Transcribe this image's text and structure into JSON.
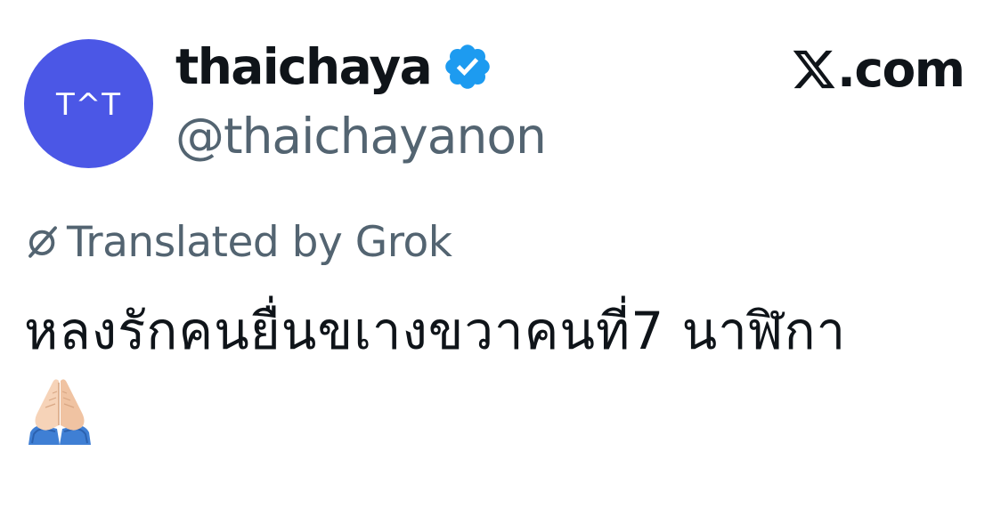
{
  "author": {
    "avatar_text": "T^T",
    "display_name": "thaichaya",
    "handle": "@thaichayanon",
    "verified": true,
    "verified_badge_icon": "verified-badge-icon",
    "avatar_color": "#4b57e6",
    "badge_color": "#1d9bf0"
  },
  "brand": {
    "logo_icon": "x-logo-icon",
    "domain_suffix": ".com"
  },
  "translation": {
    "icon": "grok-icon",
    "label": "Translated by Grok"
  },
  "tweet": {
    "text": "หลงรักคนยื่นขเางขวาคนที่7 นาฬิกา",
    "emoji": "folded-hands"
  },
  "colors": {
    "primary_text": "#0f1419",
    "secondary_text": "#536471"
  }
}
